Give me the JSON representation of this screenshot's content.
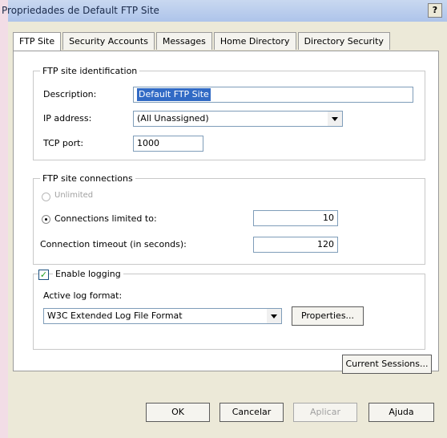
{
  "window": {
    "title": "Propriedades de Default FTP Site",
    "help_label": "?"
  },
  "tabs": [
    {
      "label": "FTP Site",
      "active": true
    },
    {
      "label": "Security Accounts",
      "active": false
    },
    {
      "label": "Messages",
      "active": false
    },
    {
      "label": "Home Directory",
      "active": false
    },
    {
      "label": "Directory Security",
      "active": false
    }
  ],
  "identification": {
    "title": "FTP site identification",
    "description_label": "Description:",
    "description_value": "Default FTP Site",
    "ip_label": "IP address:",
    "ip_value": "(All Unassigned)",
    "port_label": "TCP port:",
    "port_value": "1000"
  },
  "connections": {
    "title": "FTP site connections",
    "unlimited_label": "Unlimited",
    "limited_label": "Connections limited to:",
    "limited_value": "10",
    "timeout_label": "Connection timeout (in seconds):",
    "timeout_value": "120",
    "selected": "limited"
  },
  "logging": {
    "enable_label": "Enable logging",
    "enabled": true,
    "format_label": "Active log format:",
    "format_value": "W3C Extended Log File Format",
    "properties_button": "Properties..."
  },
  "current_sessions_button": "Current Sessions...",
  "footer": {
    "ok": "OK",
    "cancel": "Cancelar",
    "apply": "Aplicar",
    "help": "Ajuda"
  }
}
